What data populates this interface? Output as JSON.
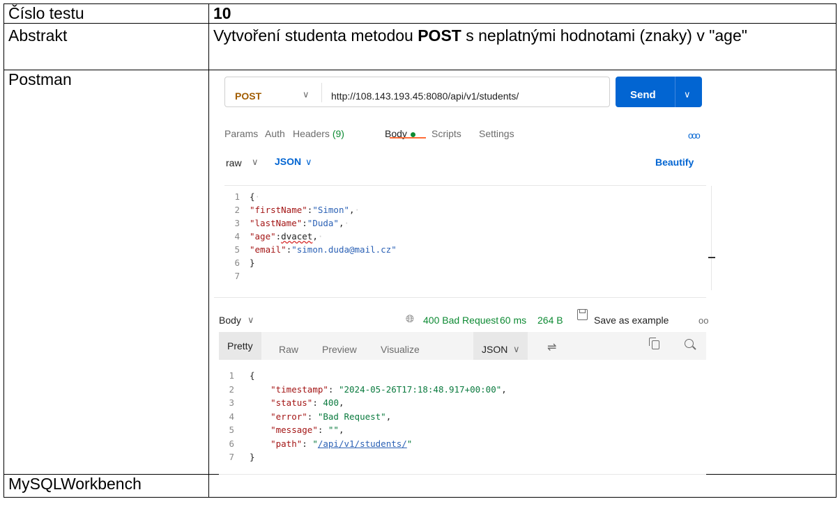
{
  "table": {
    "row1": {
      "label": "Číslo testu",
      "value": "10"
    },
    "row2": {
      "label": "Abstrakt",
      "value_pre": "Vytvoření studenta metodou ",
      "value_bold": "POST",
      "value_post": " s neplatnými hodnotami (znaky) v \"age\""
    },
    "row3": {
      "label": "Postman"
    },
    "row4": {
      "label": "MySQLWorkbench",
      "value": ""
    }
  },
  "postman": {
    "method": "POST",
    "url": "http://108.143.193.45:8080/api/v1/students/",
    "send_label": "Send",
    "tabs": [
      {
        "label": "Params"
      },
      {
        "label": "Auth"
      },
      {
        "label": "Headers",
        "count": "(9)"
      },
      {
        "label": "Body"
      },
      {
        "label": "Scripts"
      },
      {
        "label": "Settings"
      }
    ],
    "more_label": "ooo",
    "body_mode": "raw",
    "body_format": "JSON",
    "beautify_label": "Beautify",
    "request_lines": [
      {
        "n": "1"
      },
      {
        "n": "2",
        "key": "\"firstName\"",
        "val": "\"Simon\""
      },
      {
        "n": "3",
        "key": "\"lastName\"",
        "val": "\"Duda\""
      },
      {
        "n": "4",
        "key": "\"age\"",
        "val": "dvacet"
      },
      {
        "n": "5",
        "key": "\"email\"",
        "val": "\"simon.duda@mail.cz\""
      },
      {
        "n": "6"
      },
      {
        "n": "7"
      }
    ],
    "response": {
      "body_label": "Body",
      "status": "400 Bad Request",
      "time": "60 ms",
      "size": "264 B",
      "save_label": "Save as example",
      "more_label": "oo",
      "view_tabs": [
        "Pretty",
        "Raw",
        "Preview",
        "Visualize"
      ],
      "format": "JSON",
      "lines": [
        {
          "n": "1"
        },
        {
          "n": "2",
          "key": "\"timestamp\"",
          "val": "\"2024-05-26T17:18:48.917+00:00\""
        },
        {
          "n": "3",
          "key": "\"status\"",
          "val": "400"
        },
        {
          "n": "4",
          "key": "\"error\"",
          "val": "\"Bad Request\""
        },
        {
          "n": "5",
          "key": "\"message\"",
          "val": "\"\""
        },
        {
          "n": "6",
          "key": "\"path\"",
          "val": "\"/api/v1/students/\""
        },
        {
          "n": "7"
        }
      ]
    }
  }
}
